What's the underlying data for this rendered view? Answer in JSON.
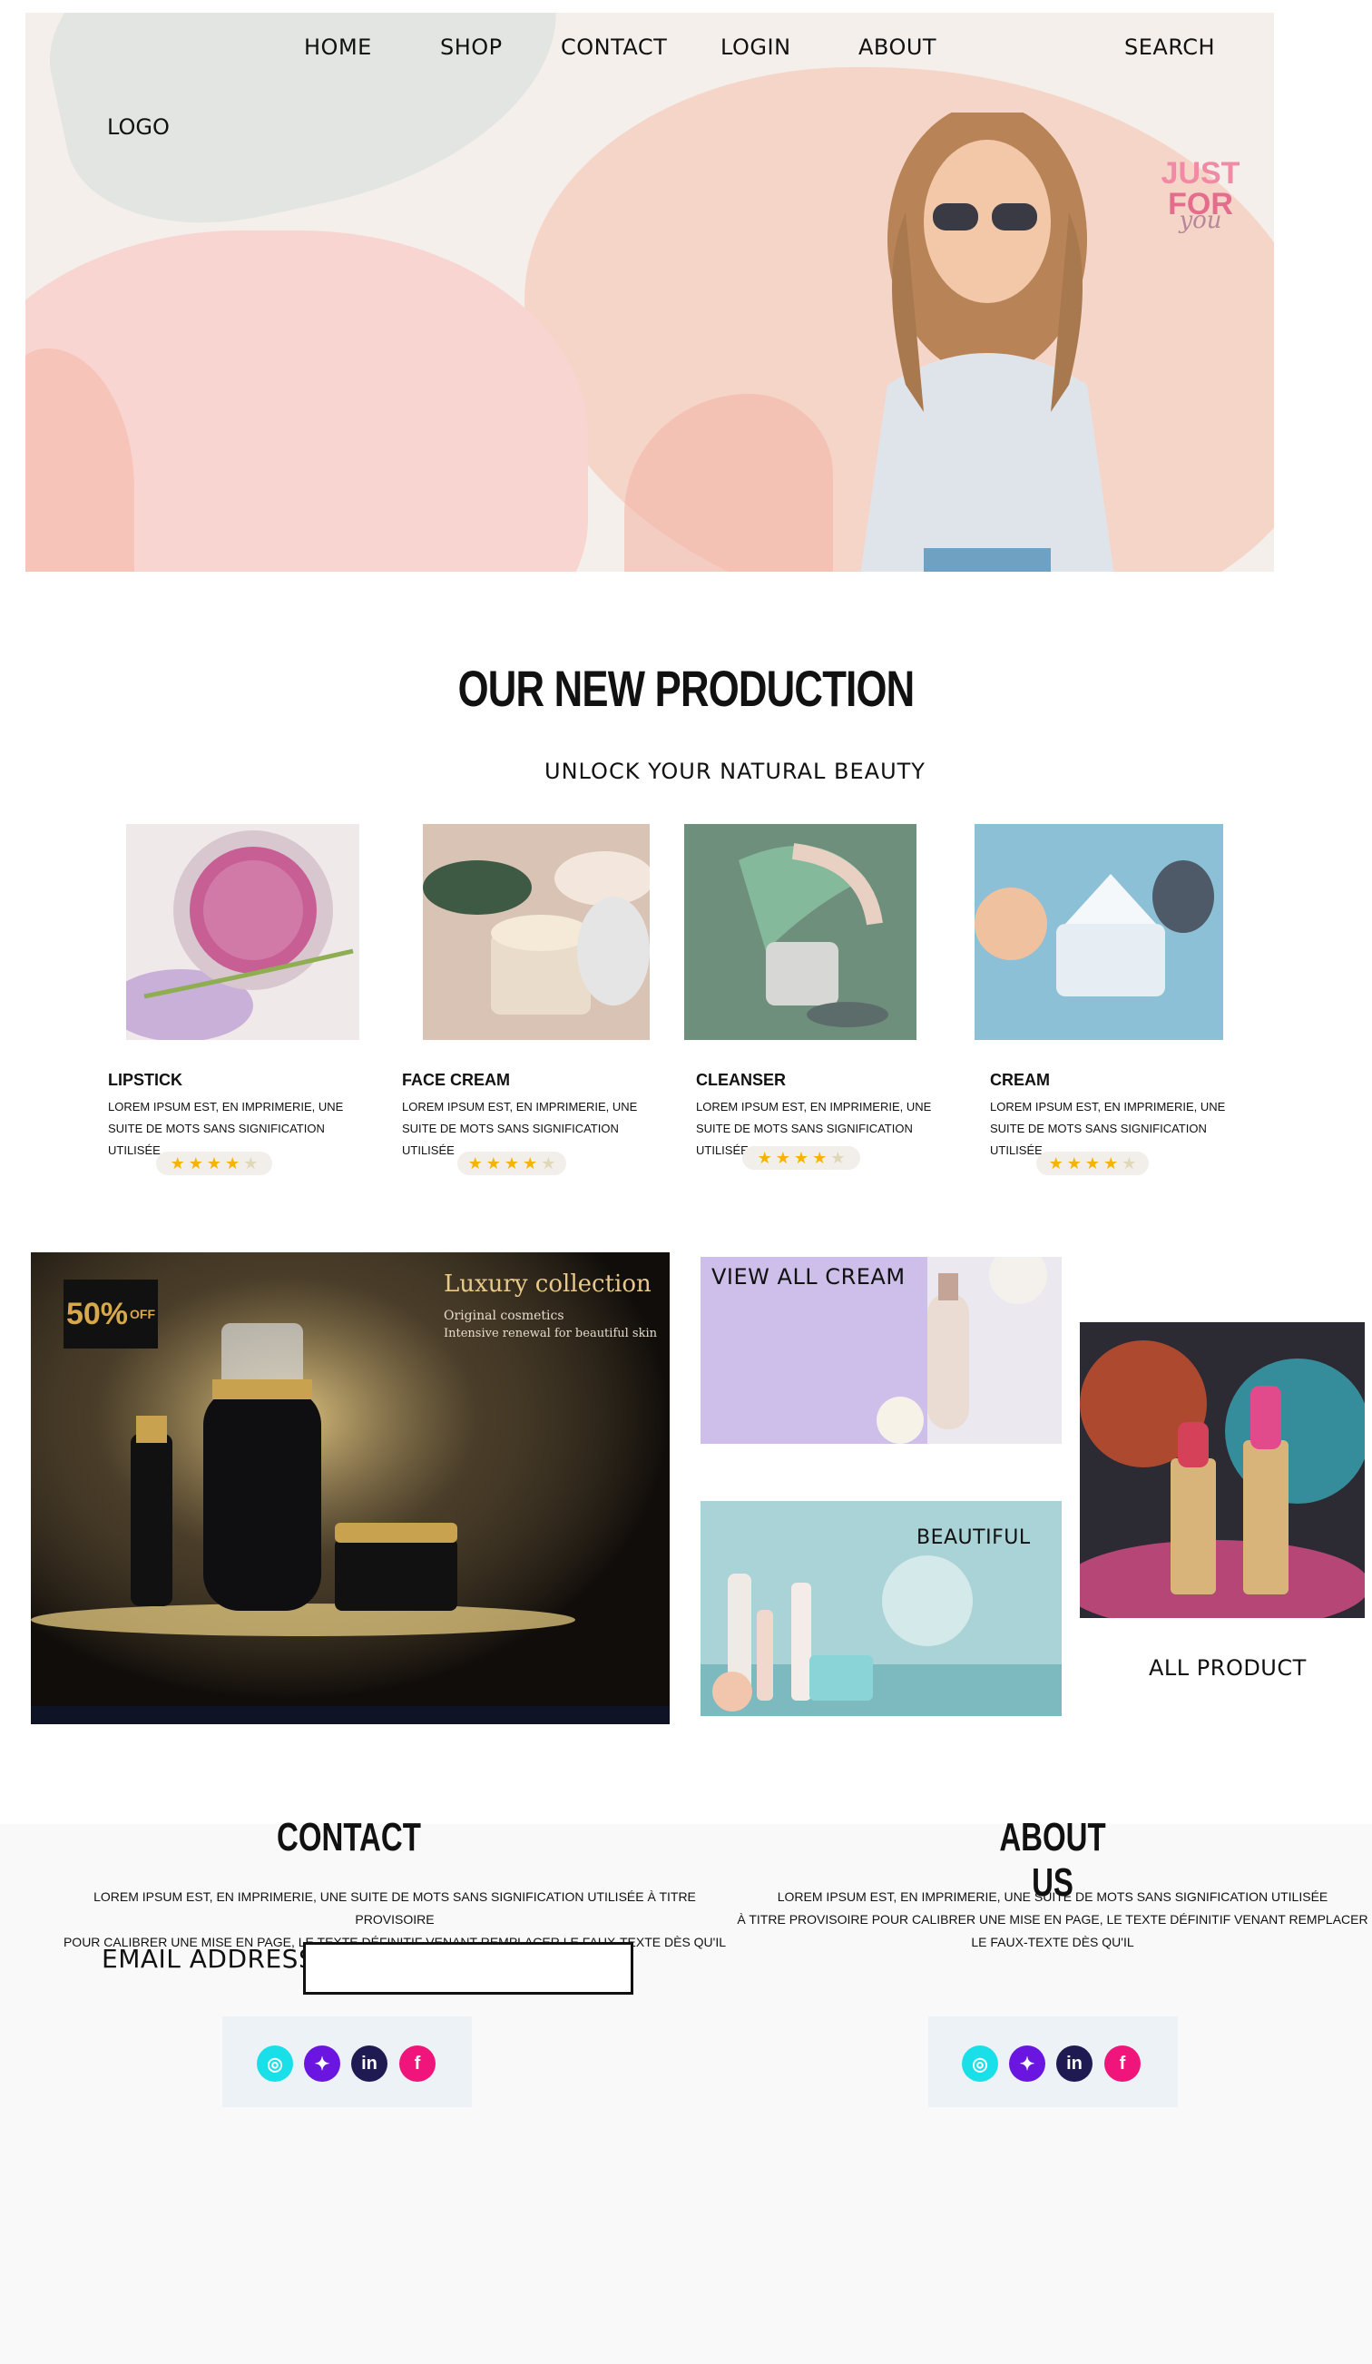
{
  "nav": {
    "home": "HOME",
    "shop": "SHOP",
    "contact": "CONTACT",
    "login": "LOGIN",
    "about": "ABOUT",
    "search": "SEARCH"
  },
  "logo": "LOGO",
  "hero_badge": {
    "line1": "JUST",
    "line2": "FOR",
    "line3": "you"
  },
  "products_section": {
    "title": "OUR NEW PRODUCTION",
    "subtitle": "UNLOCK YOUR NATURAL BEAUTY",
    "items": [
      {
        "name": "LIPSTICK",
        "description": "LOREM IPSUM EST, EN IMPRIMERIE, UNE SUITE DE MOTS SANS SIGNIFICATION UTILISÉE",
        "rating": 4,
        "rating_max": 5
      },
      {
        "name": "FACE CREAM",
        "description": "LOREM IPSUM EST, EN IMPRIMERIE, UNE SUITE DE MOTS SANS SIGNIFICATION UTILISÉE",
        "rating": 4,
        "rating_max": 5
      },
      {
        "name": "CLEANSER",
        "description": "LOREM IPSUM EST, EN IMPRIMERIE, UNE SUITE DE MOTS SANS SIGNIFICATION UTILISÉE",
        "rating": 4,
        "rating_max": 5
      },
      {
        "name": "CREAM",
        "description": "LOREM IPSUM EST, EN IMPRIMERIE, UNE SUITE DE MOTS SANS SIGNIFICATION UTILISÉE",
        "rating": 4,
        "rating_max": 5
      }
    ]
  },
  "promo": {
    "discount": "50%",
    "discount_suffix": "OFF",
    "luxury_title": "Luxury collection",
    "luxury_sub1": "Original cosmetics",
    "luxury_sub2": "Intensive renewal for beautiful skin",
    "view_all_cream": "VIEW ALL CREAM",
    "beautiful": "BEAUTIFUL",
    "all_product": "ALL  PRODUCT"
  },
  "contact": {
    "title": "CONTACT",
    "text_line1": "LOREM IPSUM EST, EN IMPRIMERIE, UNE SUITE DE MOTS SANS SIGNIFICATION UTILISÉE À TITRE PROVISOIRE",
    "text_line2": "POUR CALIBRER UNE MISE EN PAGE, LE TEXTE DÉFINITIF VENANT REMPLACER LE FAUX-TEXTE DÈS QU'IL",
    "email_label": "EMAIL ADDRESS",
    "email_value": ""
  },
  "about": {
    "title": "ABOUT US",
    "text_line1": "LOREM IPSUM EST, EN IMPRIMERIE, UNE SUITE DE MOTS SANS SIGNIFICATION UTILISÉE",
    "text_line2": "À TITRE PROVISOIRE POUR CALIBRER UNE MISE EN PAGE, LE TEXTE DÉFINITIF VENANT REMPLACER",
    "text_line3": "LE FAUX-TEXTE DÈS QU'IL"
  },
  "social_icons": [
    "instagram-icon",
    "twitter-icon",
    "linkedin-icon",
    "facebook-icon"
  ],
  "colors": {
    "instagram": "#19e0e8",
    "twitter": "#6a16e0",
    "linkedin": "#1f1a52",
    "facebook": "#f0157a",
    "star": "#f4b400"
  }
}
